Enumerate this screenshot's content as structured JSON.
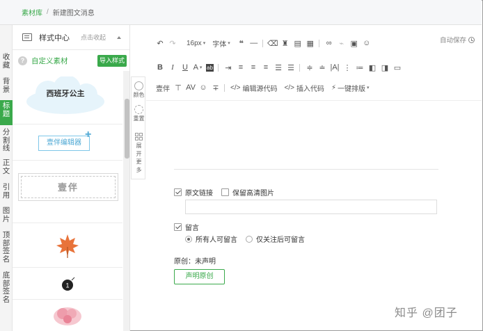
{
  "breadcrumb": {
    "root": "素材库",
    "separator": "/",
    "current": "新建图文消息"
  },
  "vtabs": [
    {
      "label": "收藏",
      "active": false
    },
    {
      "label": "背景",
      "active": false
    },
    {
      "label": "标题",
      "active": true
    },
    {
      "label": "分割线",
      "active": false
    },
    {
      "label": "正文",
      "active": false
    },
    {
      "label": "引用",
      "active": false
    },
    {
      "label": "图片",
      "active": false
    },
    {
      "label": "顶部签名",
      "active": false
    },
    {
      "label": "底部签名",
      "active": false
    }
  ],
  "panel": {
    "title": "样式中心",
    "collapse_label": "点击收起",
    "custom_label": "自定义素材",
    "import_label": "导入样式",
    "items": {
      "cloud_title": "西班牙公主",
      "editor_badge": "壹伴编辑器",
      "yiban_box": "壹伴"
    }
  },
  "sidetools": {
    "color": "颜色",
    "reset": "重置",
    "expand": "展开更多"
  },
  "editor": {
    "autosave": "自动保存",
    "toolbar1": {
      "font_size": "16px",
      "font_family": "字体"
    },
    "toolbar3": {
      "yiban": "壹伴",
      "edit_source": "编辑源代码",
      "insert_code": "插入代码",
      "one_click": "一键排版"
    },
    "options": {
      "original_link": "原文链接",
      "keep_hd": "保留高清图片",
      "link_value": "",
      "comment": "留言",
      "everyone": "所有人可留言",
      "followers_only": "仅关注后可留言",
      "original_status": "原创：未声明",
      "declare_button": "声明原创"
    }
  },
  "watermark": "知乎 @团子",
  "colors": {
    "accent": "#3aa94b",
    "badge_border": "#7ec6e8"
  }
}
